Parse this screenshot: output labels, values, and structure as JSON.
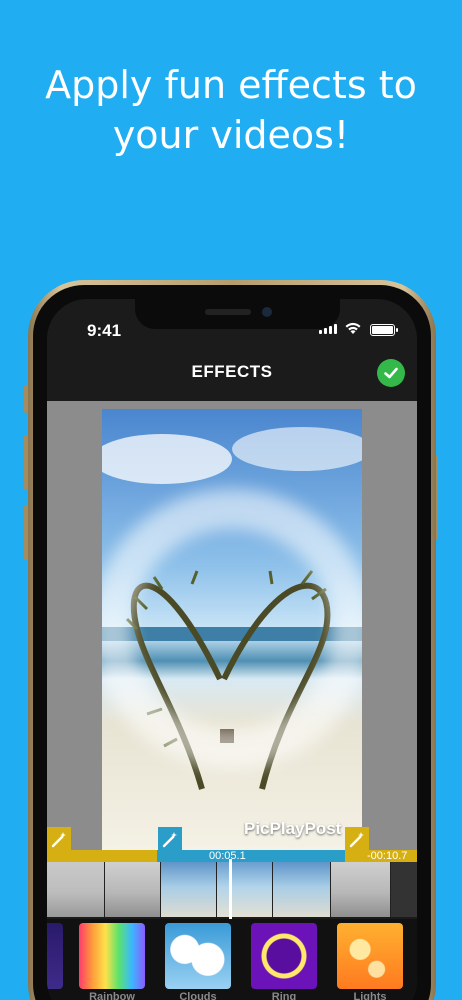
{
  "headline": {
    "line1": "Apply fun effects to",
    "line2": "your videos!"
  },
  "status_bar": {
    "time": "9:41"
  },
  "nav": {
    "title": "EFFECTS",
    "done_icon": "checkmark-icon"
  },
  "preview": {
    "watermark": "PicPlayPost"
  },
  "timeline": {
    "current_time": "00:05.1",
    "remaining_time": "-00:10.7"
  },
  "effects": [
    {
      "label": "Rainbow",
      "icon": "rainbow-effect"
    },
    {
      "label": "Clouds",
      "icon": "clouds-effect"
    },
    {
      "label": "Ring",
      "icon": "ring-effect"
    },
    {
      "label": "Lights",
      "icon": "lights-effect"
    }
  ],
  "colors": {
    "background": "#21adf2",
    "accent_yellow": "#d6b012",
    "accent_blue": "#2a9dc8",
    "done_green": "#34b84a"
  }
}
